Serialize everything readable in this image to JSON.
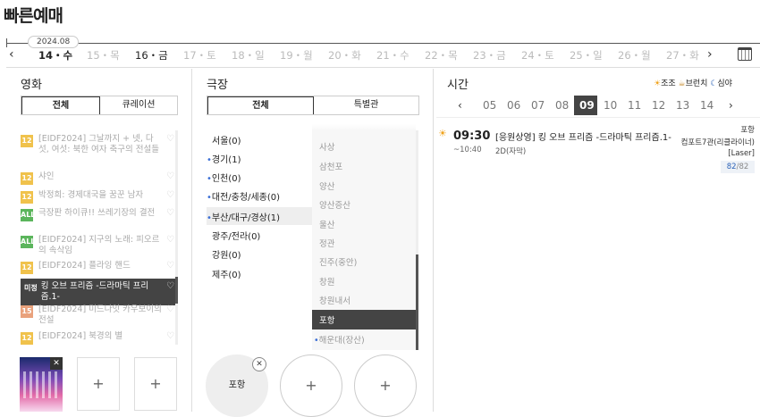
{
  "page_title": "빠른예매",
  "date_bar": {
    "year_month": "2024.08",
    "prev_arrow": "‹",
    "next_arrow": "›",
    "days": [
      {
        "label": "14・수",
        "state": "selected"
      },
      {
        "label": "15・목",
        "state": "disabled"
      },
      {
        "label": "16・금",
        "state": "enabled"
      },
      {
        "label": "17・토",
        "state": "disabled"
      },
      {
        "label": "18・일",
        "state": "disabled"
      },
      {
        "label": "19・월",
        "state": "disabled"
      },
      {
        "label": "20・화",
        "state": "disabled"
      },
      {
        "label": "21・수",
        "state": "disabled"
      },
      {
        "label": "22・목",
        "state": "disabled"
      },
      {
        "label": "23・금",
        "state": "disabled"
      },
      {
        "label": "24・토",
        "state": "disabled"
      },
      {
        "label": "25・일",
        "state": "disabled"
      },
      {
        "label": "26・월",
        "state": "disabled"
      },
      {
        "label": "27・화",
        "state": "disabled"
      }
    ]
  },
  "movie": {
    "heading": "영화",
    "tabs": [
      "전체",
      "큐레이션"
    ],
    "items": [
      {
        "rating": "12",
        "title": "[EIDF2024] 그날까지 + 넷, 다섯, 여섯: 북한 여자 축구의 전설들"
      },
      {
        "rating": "12",
        "title": "샤인"
      },
      {
        "rating": "12",
        "title": "박정희: 경제대국을 꿈꾼 남자"
      },
      {
        "rating": "ALL",
        "title": "극장판 하이큐!! 쓰레기장의 결전"
      },
      {
        "rating": "ALL",
        "title": "[EIDF2024] 지구의 노래: 피오르의 속삭임"
      },
      {
        "rating": "12",
        "title": "[EIDF2024] 플라잉 핸드"
      },
      {
        "rating": "미정",
        "title": "킹 오브 프리즘 -드라마틱 프리즘.1-"
      },
      {
        "rating": "15",
        "title": "[EIDF2024] 미드나잇 카우보이의 전설"
      },
      {
        "rating": "12",
        "title": "[EIDF2024] 북경의 별"
      }
    ],
    "add_label": "+",
    "remove_label": "✕"
  },
  "theater": {
    "heading": "극장",
    "tabs": [
      "전체",
      "특별관"
    ],
    "regions": [
      {
        "label": "서울(0)",
        "dot": false
      },
      {
        "label": "경기(1)",
        "dot": true
      },
      {
        "label": "인천(0)",
        "dot": true
      },
      {
        "label": "대전/충청/세종(0)",
        "dot": true
      },
      {
        "label": "부산/대구/경상(1)",
        "dot": true
      },
      {
        "label": "광주/전라(0)",
        "dot": false
      },
      {
        "label": "강원(0)",
        "dot": false
      },
      {
        "label": "제주(0)",
        "dot": false
      }
    ],
    "cities": [
      {
        "label": "사상",
        "dot": false
      },
      {
        "label": "삼천포",
        "dot": false
      },
      {
        "label": "양산",
        "dot": false
      },
      {
        "label": "양산증산",
        "dot": false
      },
      {
        "label": "울산",
        "dot": false
      },
      {
        "label": "정관",
        "dot": false
      },
      {
        "label": "진주(중안)",
        "dot": false
      },
      {
        "label": "창원",
        "dot": false
      },
      {
        "label": "창원내서",
        "dot": false
      },
      {
        "label": "포항",
        "dot": false
      },
      {
        "label": "해운대(장산)",
        "dot": true
      }
    ],
    "selected_label": "포항",
    "add_label": "+",
    "remove_label": "✕"
  },
  "time": {
    "heading": "시간",
    "legend": [
      "조조",
      "브런치",
      "심야"
    ],
    "hours": [
      "05",
      "06",
      "07",
      "08",
      "09",
      "10",
      "11",
      "12",
      "13",
      "14"
    ],
    "selected_hour": "09",
    "showing": {
      "start": "09:30",
      "end": "~10:40",
      "title": "[응원상영] 킹 오브 프리즘 -드라마틱 프리즘.1-",
      "format": "2D(자막)",
      "cinema": "포항",
      "screen": "컴포트7관(리클라이너)",
      "screen_type": "[Laser]",
      "seats_left": "82",
      "seats_total": "82"
    }
  },
  "colors": {
    "accent": "#503396",
    "selected_bg": "#444444",
    "badge_12": "#f0c24c",
    "badge_all": "#5bb55c",
    "badge_15": "#e9a27d",
    "dot": "#3b6fd6",
    "seat_blue": "#2e64b8"
  }
}
